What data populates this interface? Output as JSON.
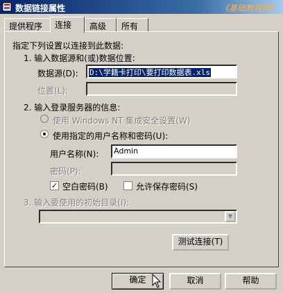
{
  "window": {
    "title": "数据链接属性",
    "watermark": "《基础教程网》"
  },
  "tabs": [
    {
      "label": "提供程序",
      "active": false
    },
    {
      "label": "连接",
      "active": true
    },
    {
      "label": "高级",
      "active": false
    },
    {
      "label": "所有",
      "active": false
    }
  ],
  "intro": "指定下列设置以连接到此数据:",
  "step1": {
    "heading": "1. 输入数据源和(或)数据位置:",
    "datasource_label": "数据源(D):",
    "datasource_value": "D:\\学籍卡打印\\要打印数据表.xls",
    "location_label": "位置(L):",
    "location_value": ""
  },
  "step2": {
    "heading": "2. 输入登录服务器的信息:",
    "opt_windows_nt": "使用 Windows NT 集成安全设置(W)",
    "opt_specific_user": "使用指定的用户名称和密码(U):",
    "username_label": "用户名称(N):",
    "username_value": "Admin",
    "password_label": "密码(P):",
    "password_value": "",
    "blank_password": "空白密码(B)",
    "blank_password_checked": true,
    "allow_save_password": "允许保存密码(S)",
    "allow_save_password_checked": false
  },
  "step3": {
    "heading": "3. 输入要使用的初始目录(I):",
    "catalog_value": ""
  },
  "buttons": {
    "test": "测试连接(T)",
    "ok": "确定",
    "cancel": "取消",
    "help": "帮助"
  }
}
